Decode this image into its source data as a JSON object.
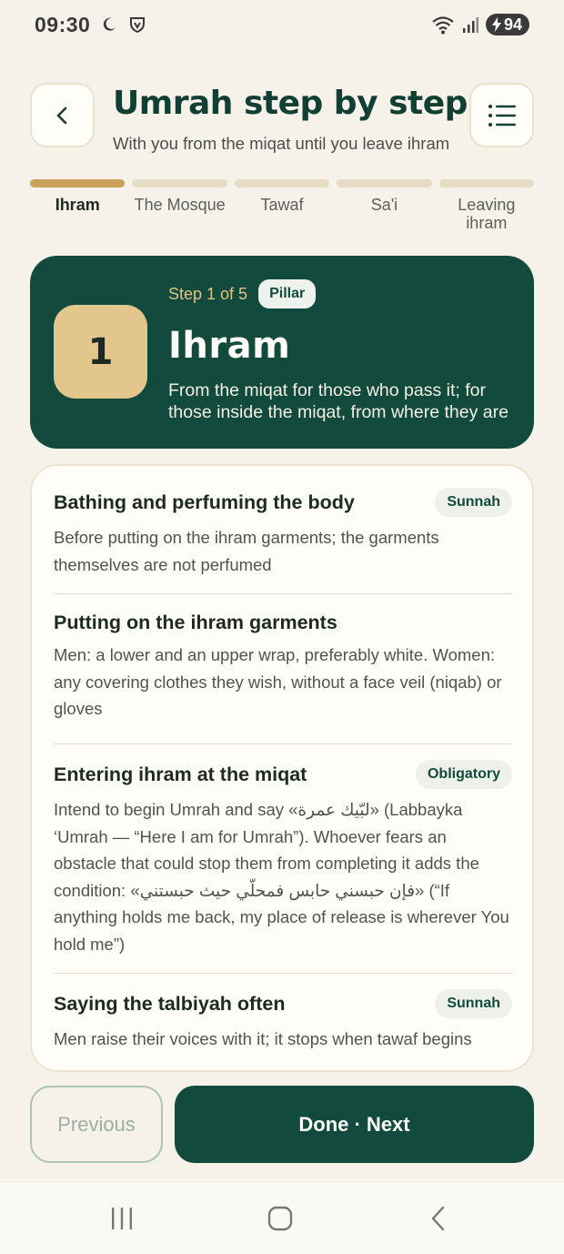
{
  "status_bar": {
    "time": "09:30",
    "battery": "94",
    "icons": [
      "moon-icon",
      "vpn-shield-icon",
      "wifi-icon",
      "signal-icon",
      "battery-charging-icon"
    ]
  },
  "header": {
    "title": "Umrah step by step",
    "subtitle": "With you from the miqat until you leave ihram",
    "back_icon": "chevron-left-icon",
    "menu_icon": "list-icon"
  },
  "progress": {
    "current": 1,
    "total": 5,
    "tabs": [
      {
        "label": "Ihram"
      },
      {
        "label": "The Mosque"
      },
      {
        "label": "Tawaf"
      },
      {
        "label": "Sa'i"
      },
      {
        "label": "Leaving ihram"
      }
    ]
  },
  "step": {
    "number": "1",
    "count_label": "Step 1 of 5",
    "badge": "Pillar",
    "title": "Ihram",
    "description": "From the miqat for those who pass it; for those inside the miqat, from where they are"
  },
  "items": [
    {
      "title": "Bathing and perfuming the body",
      "badge": "Sunnah",
      "description": "Before putting on the ihram garments; the garments themselves are not perfumed"
    },
    {
      "title": "Putting on the ihram garments",
      "badge": "",
      "description": "Men: a lower and an upper wrap, preferably white. Women: any covering clothes they wish, without a face veil (niqab) or gloves"
    },
    {
      "title": "Entering ihram at the miqat",
      "badge": "Obligatory",
      "description": "Intend to begin Umrah and say «لبّيك عمرة» (Labbayka ‘Umrah — “Here I am for Umrah”). Whoever fears an obstacle that could stop them from completing it adds the condition: «فإن حبسني حابس فمحلّي حيث حبستني» (“If anything holds me back, my place of release is wherever You hold me”)"
    },
    {
      "title": "Saying the talbiyah often",
      "badge": "Sunnah",
      "description": "Men raise their voices with it; it stops when tawaf begins"
    }
  ],
  "buttons": {
    "previous": "Previous",
    "next": "Done · Next"
  },
  "colors": {
    "primary": "#124a3d",
    "accent": "#c9a35c",
    "step_number_bg": "#e2c68b",
    "background": "#f6f2ea"
  }
}
